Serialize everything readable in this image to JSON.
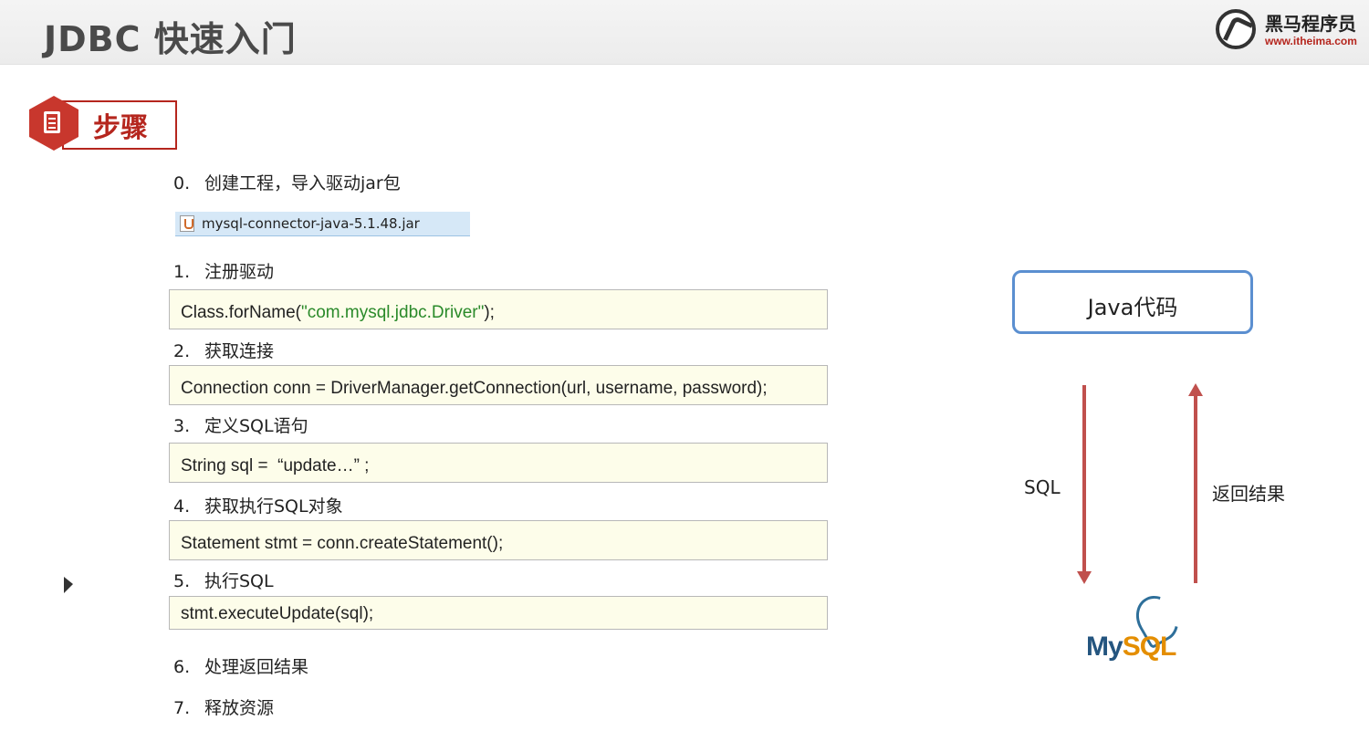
{
  "header": {
    "title": "JDBC 快速入门",
    "logo_name": "黑马程序员",
    "logo_url": "www.itheima.com"
  },
  "section": {
    "label": "步骤"
  },
  "steps": [
    {
      "num": "0.",
      "text": "创建工程，导入驱动jar包"
    },
    {
      "num": "1.",
      "text": "注册驱动"
    },
    {
      "num": "2.",
      "text": "获取连接"
    },
    {
      "num": "3.",
      "text": "定义SQL语句"
    },
    {
      "num": "4.",
      "text": "获取执行SQL对象"
    },
    {
      "num": "5.",
      "text": "执行SQL"
    },
    {
      "num": "6.",
      "text": "处理返回结果"
    },
    {
      "num": "7.",
      "text": "释放资源"
    }
  ],
  "jar": {
    "filename": "mysql-connector-java-5.1.48.jar",
    "icon": "java-jar-icon"
  },
  "code": {
    "register_prefix": "Class.forName(",
    "register_string": "\"com.mysql.jdbc.Driver\"",
    "register_suffix": ");",
    "connection": "Connection conn = DriverManager.getConnection(url, username, password);",
    "sql": "String sql =  “update…” ;",
    "statement": "Statement stmt = conn.createStatement();",
    "execute": "stmt.executeUpdate(sql);"
  },
  "diagram": {
    "java_box": "Java代码",
    "down_label": "SQL",
    "up_label": "返回结果",
    "mysql_my": "My",
    "mysql_sql": "SQL",
    "arrow_color": "#c0504d",
    "box_border_color": "#5b8fd0"
  },
  "colors": {
    "accent": "#b5261e",
    "code_bg": "#fdfdea",
    "code_string": "#2a8a2a"
  }
}
